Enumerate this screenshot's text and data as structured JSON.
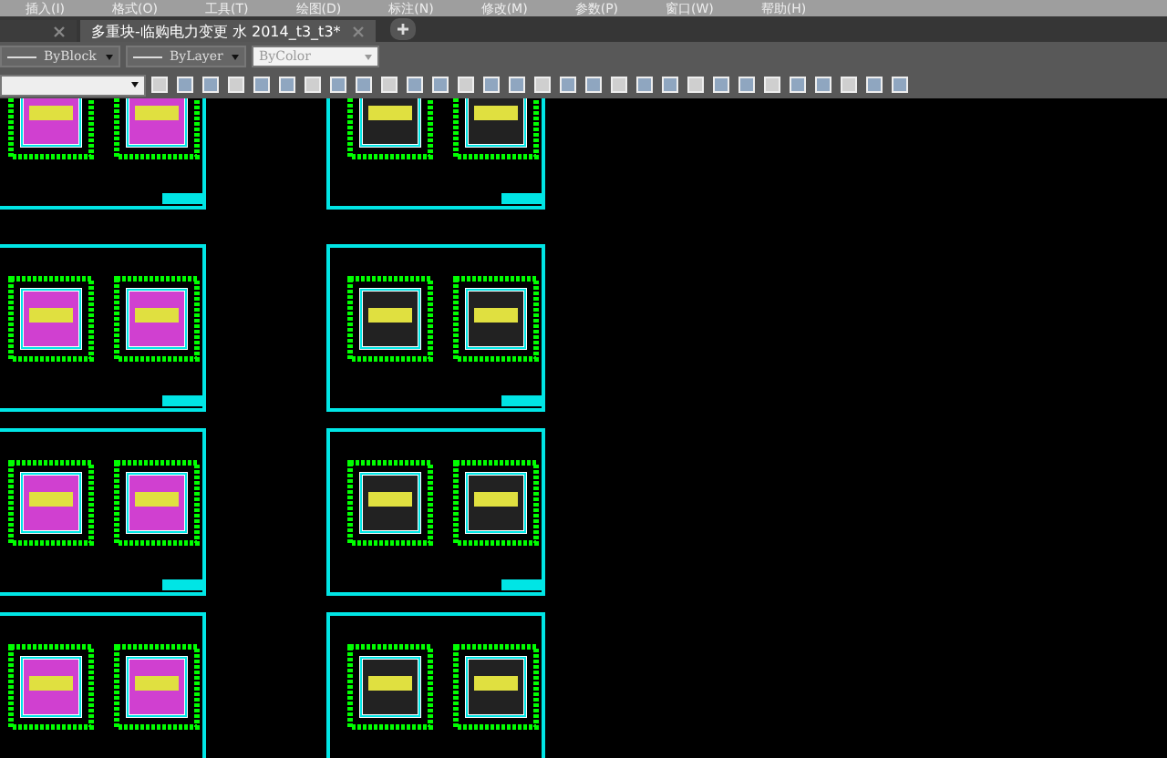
{
  "menu": [
    "插入(I)",
    "格式(O)",
    "工具(T)",
    "绘图(D)",
    "标注(N)",
    "修改(M)",
    "参数(P)",
    "窗口(W)",
    "帮助(H)"
  ],
  "tabs": [
    {
      "selected": false
    },
    {
      "label": "多重块-临购电力变更 水  2014_t3_t3*",
      "selected": true
    }
  ],
  "properties": [
    {
      "kind": "line",
      "value": "ByBlock"
    },
    {
      "kind": "line",
      "value": "ByLayer"
    },
    {
      "kind": "color",
      "value": "ByColor"
    }
  ]
}
